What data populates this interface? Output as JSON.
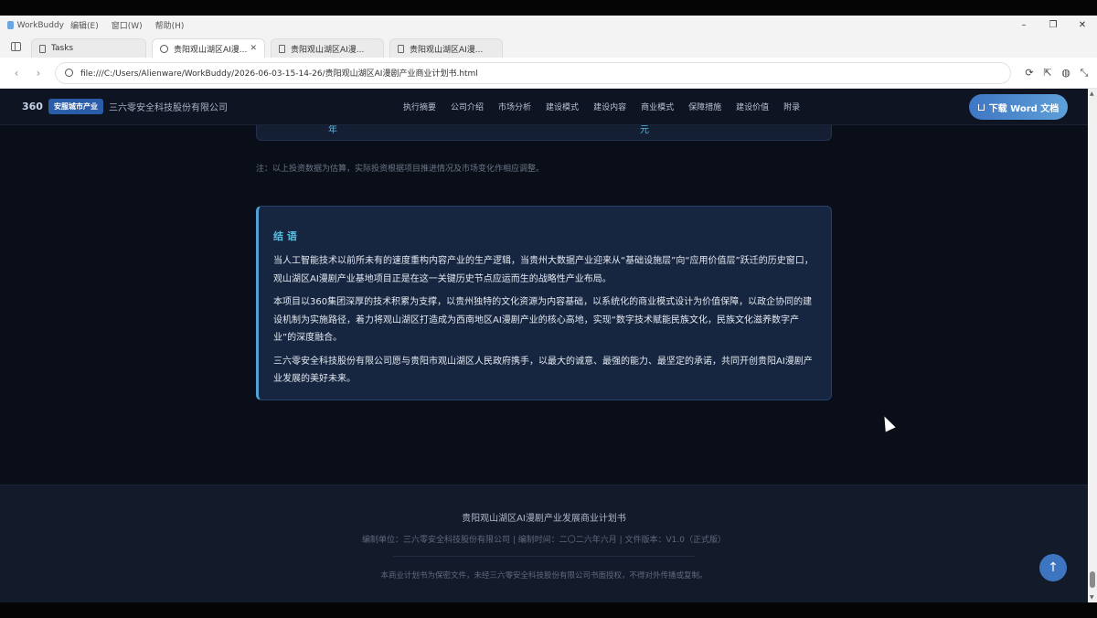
{
  "window": {
    "app_name": "WorkBuddy",
    "menus": [
      "编辑(E)",
      "窗口(W)",
      "帮助(H)"
    ],
    "controls": [
      "–",
      "❐",
      "✕"
    ]
  },
  "tabs": [
    {
      "label": "Tasks",
      "active": false
    },
    {
      "label": "贵阳观山湖区AI漫...",
      "active": true
    },
    {
      "label": "贵阳观山湖区AI漫...",
      "active": false
    },
    {
      "label": "贵阳观山湖区AI漫...",
      "active": false
    }
  ],
  "address": {
    "url": "file:///C:/Users/Alienware/WorkBuddy/2026-06-03-15-14-26/贵阳观山湖区AI漫剧产业商业计划书.html"
  },
  "header": {
    "logo": "360",
    "badge": "安服城市产业",
    "company": "三六零安全科技股份有限公司",
    "nav": [
      "执行摘要",
      "公司介绍",
      "市场分析",
      "建设模式",
      "建设内容",
      "商业模式",
      "保障措施",
      "建设价值",
      "附录"
    ],
    "download_label": "下载 Word 文档"
  },
  "table_cut": {
    "cell1": "年",
    "cell2": "元"
  },
  "note": "注：以上投资数据为估算，实际投资根据项目推进情况及市场变化作相应调整。",
  "conclusion": {
    "title": "结 语",
    "paragraphs": [
      "当人工智能技术以前所未有的速度重构内容产业的生产逻辑，当贵州大数据产业迎来从“基础设施层”向“应用价值层”跃迁的历史窗口，观山湖区AI漫剧产业基地项目正是在这一关键历史节点应运而生的战略性产业布局。",
      "本项目以360集团深厚的技术积累为支撑，以贵州独特的文化资源为内容基础，以系统化的商业模式设计为价值保障，以政企协同的建设机制为实施路径，着力将观山湖区打造成为西南地区AI漫剧产业的核心高地，实现“数字技术赋能民族文化，民族文化滋养数字产业”的深度融合。",
      "三六零安全科技股份有限公司愿与贵阳市观山湖区人民政府携手，以最大的诚意、最强的能力、最坚定的承诺，共同开创贵阳AI漫剧产业发展的美好未来。"
    ]
  },
  "footer": {
    "title": "贵阳观山湖区AI漫剧产业发展商业计划书",
    "meta": "编制单位：三六零安全科技股份有限公司 | 编制时间：二〇二六年六月 | 文件版本：V1.0（正式版）",
    "copyright": "本商业计划书为保密文件，未经三六零安全科技股份有限公司书面授权，不得对外传播或复制。"
  },
  "back_to_top": "↑"
}
